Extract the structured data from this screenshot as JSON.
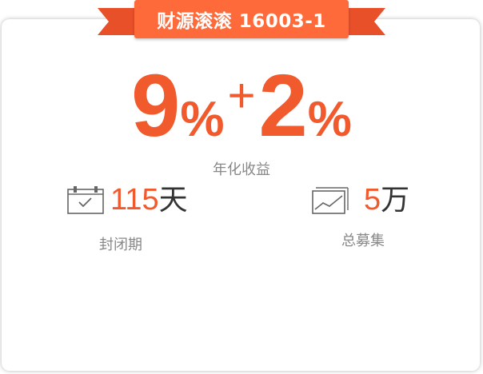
{
  "banner": {
    "title": "财源滚滚 16003-1"
  },
  "rate": {
    "base_value": "9",
    "base_unit": "%",
    "plus_sign": "+",
    "bonus_value": "2",
    "bonus_unit": "%",
    "label": "年化收益"
  },
  "stats": {
    "lock_period": {
      "icon": "calendar-icon",
      "value": "115",
      "unit": "天",
      "label": "封闭期"
    },
    "raise_total": {
      "icon": "trend-chart-icon",
      "value": "5",
      "unit": "万",
      "label": "总募集"
    }
  },
  "colors": {
    "accent": "#f05a2c",
    "ribbon": "#ff6a3a",
    "ribbon_tail": "#e8502a",
    "muted": "#888888"
  }
}
